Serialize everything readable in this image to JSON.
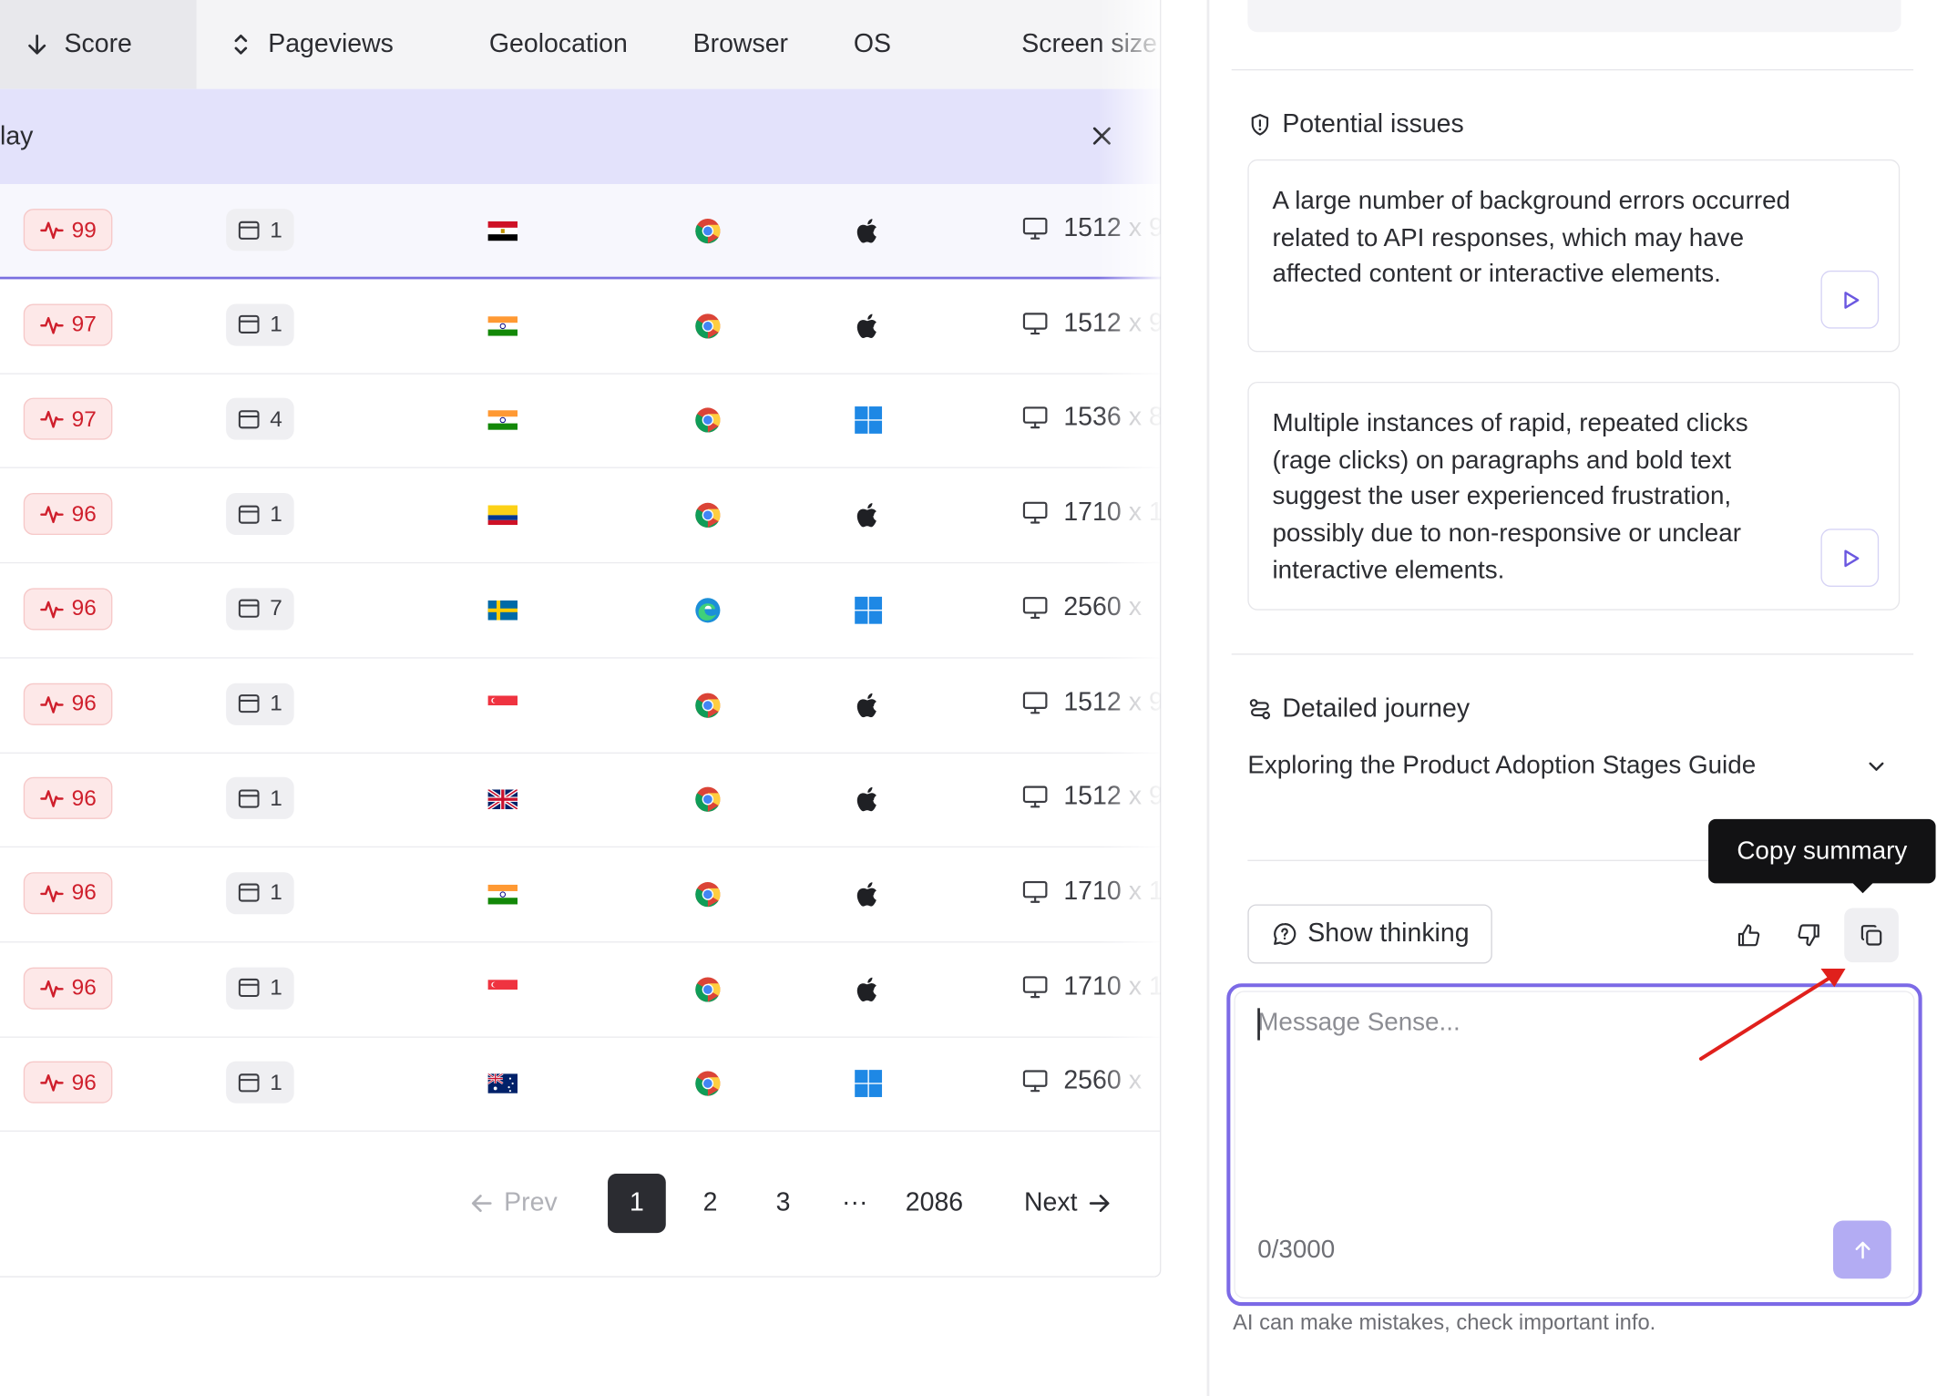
{
  "table": {
    "headers": {
      "score": "Score",
      "pageviews": "Pageviews",
      "geolocation": "Geolocation",
      "browser": "Browser",
      "os": "OS",
      "screen_size": "Screen size"
    },
    "banner_text": "lay",
    "rows": [
      {
        "score": "99",
        "pageviews": "1",
        "flag": "egypt-flag",
        "browser": "chrome-icon",
        "os": "apple-icon",
        "screen_w": "1512",
        "screen_rest": "x 9"
      },
      {
        "score": "97",
        "pageviews": "1",
        "flag": "india-flag",
        "browser": "chrome-icon",
        "os": "apple-icon",
        "screen_w": "1512",
        "screen_rest": "x 9"
      },
      {
        "score": "97",
        "pageviews": "4",
        "flag": "india-flag",
        "browser": "chrome-icon",
        "os": "windows-icon",
        "screen_w": "1536",
        "screen_rest": "x 8"
      },
      {
        "score": "96",
        "pageviews": "1",
        "flag": "colombia-flag",
        "browser": "chrome-icon",
        "os": "apple-icon",
        "screen_w": "1710",
        "screen_rest": "x 1"
      },
      {
        "score": "96",
        "pageviews": "7",
        "flag": "sweden-flag",
        "browser": "edge-icon",
        "os": "windows-icon",
        "screen_w": "2560",
        "screen_rest": "x"
      },
      {
        "score": "96",
        "pageviews": "1",
        "flag": "singapore-flag",
        "browser": "chrome-icon",
        "os": "apple-icon",
        "screen_w": "1512",
        "screen_rest": "x 9"
      },
      {
        "score": "96",
        "pageviews": "1",
        "flag": "uk-flag",
        "browser": "chrome-icon",
        "os": "apple-icon",
        "screen_w": "1512",
        "screen_rest": "x 9"
      },
      {
        "score": "96",
        "pageviews": "1",
        "flag": "india-flag",
        "browser": "chrome-icon",
        "os": "apple-icon",
        "screen_w": "1710",
        "screen_rest": "x 1"
      },
      {
        "score": "96",
        "pageviews": "1",
        "flag": "singapore-flag",
        "browser": "chrome-icon",
        "os": "apple-icon",
        "screen_w": "1710",
        "screen_rest": "x 1"
      },
      {
        "score": "96",
        "pageviews": "1",
        "flag": "australia-flag",
        "browser": "chrome-icon",
        "os": "windows-icon",
        "screen_w": "2560",
        "screen_rest": "x"
      }
    ]
  },
  "pagination": {
    "prev": "Prev",
    "pages": [
      "1",
      "2",
      "3"
    ],
    "ellipsis": "···",
    "last": "2086",
    "next": "Next",
    "current": "1"
  },
  "panel": {
    "potential_issues_title": "Potential issues",
    "issues": [
      "A large number of background errors occurred related to API responses, which may have affected content or interactive elements.",
      "Multiple instances of rapid, repeated clicks (rage clicks) on paragraphs and bold text suggest the user experienced frustration, possibly due to non-responsive or unclear interactive elements."
    ],
    "detailed_journey_title": "Detailed journey",
    "journey_selected": "Exploring the Product Adoption Stages Guide",
    "tooltip": "Copy summary",
    "show_thinking": "Show thinking",
    "message_placeholder": "Message Sense...",
    "char_counter": "0/3000",
    "disclaimer": "AI can make mistakes, check important info."
  },
  "colors": {
    "accent": "#7c6ae6",
    "score_red": "#cf1f2c",
    "banner_bg": "#e3e2fb",
    "annotation_arrow": "#e0201c"
  }
}
